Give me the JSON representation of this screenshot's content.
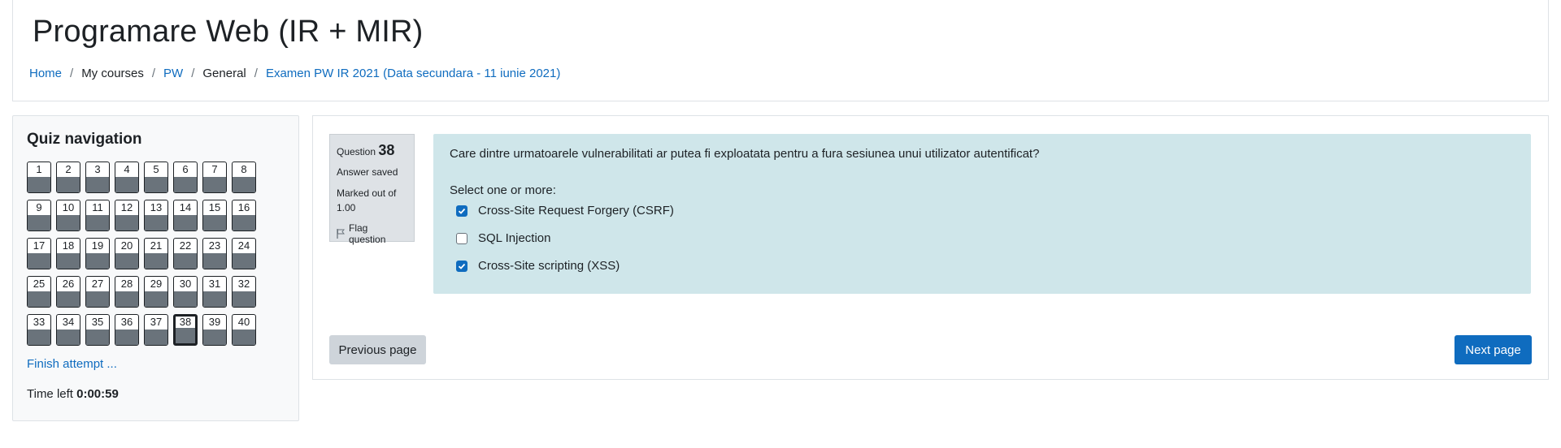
{
  "header": {
    "title": "Programare Web (IR + MIR)",
    "breadcrumb": [
      {
        "label": "Home",
        "link": true
      },
      {
        "label": "My courses",
        "link": false
      },
      {
        "label": "PW",
        "link": true
      },
      {
        "label": "General",
        "link": false
      },
      {
        "label": "Examen PW IR 2021 (Data secundara - 11 iunie 2021)",
        "link": true
      }
    ],
    "separator": "/"
  },
  "quiz_nav": {
    "title": "Quiz navigation",
    "questions": [
      "1",
      "2",
      "3",
      "4",
      "5",
      "6",
      "7",
      "8",
      "9",
      "10",
      "11",
      "12",
      "13",
      "14",
      "15",
      "16",
      "17",
      "18",
      "19",
      "20",
      "21",
      "22",
      "23",
      "24",
      "25",
      "26",
      "27",
      "28",
      "29",
      "30",
      "31",
      "32",
      "33",
      "34",
      "35",
      "36",
      "37",
      "38",
      "39",
      "40"
    ],
    "current": "38",
    "finish_label": "Finish attempt ...",
    "time_label": "Time left",
    "time_value": "0:00:59"
  },
  "question": {
    "label": "Question",
    "number": "38",
    "state": "Answer saved",
    "grade": "Marked out of 1.00",
    "flag_label": "Flag question",
    "text": "Care dintre urmatoarele vulnerabilitati ar putea fi exploatata pentru a fura sesiunea unui utilizator autentificat?",
    "prompt": "Select one or more:",
    "answers": [
      {
        "label": "Cross-Site Request Forgery (CSRF)",
        "checked": true
      },
      {
        "label": "SQL Injection",
        "checked": false
      },
      {
        "label": "Cross-Site scripting (XSS)",
        "checked": true
      }
    ]
  },
  "nav_buttons": {
    "previous": "Previous page",
    "next": "Next page"
  },
  "colors": {
    "link": "#0f6cbf",
    "question_bg": "#cfe6ea",
    "answered_fill": "#6a737b",
    "primary": "#0f6cbf"
  }
}
